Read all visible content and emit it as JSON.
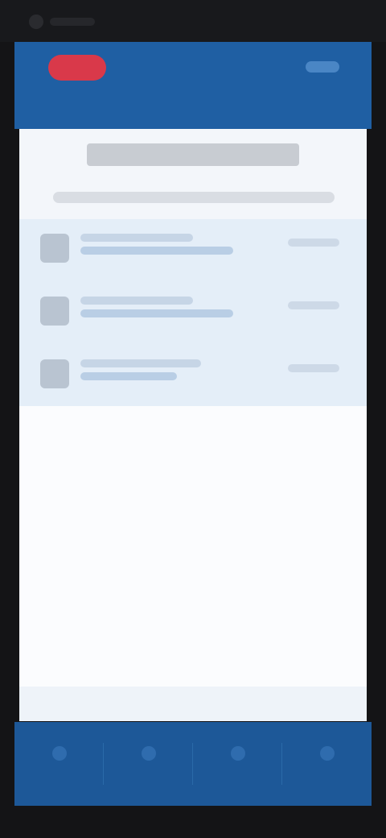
{
  "colors": {
    "header": "#1f5fa3",
    "brand_badge": "#d9394a",
    "content_background": "#f3f6fa",
    "list_background": "#e4eef8",
    "bottom_nav": "#1d5898",
    "frame": "#141416"
  },
  "header": {
    "brand_badge_icon": "brand-logo-icon",
    "action_icon": "menu-icon"
  },
  "list": {
    "items": [
      {
        "icon": "document-icon"
      },
      {
        "icon": "document-icon"
      },
      {
        "icon": "document-icon"
      }
    ]
  },
  "bottom_nav": {
    "items": [
      {
        "icon": "home-icon"
      },
      {
        "icon": "search-icon"
      },
      {
        "icon": "list-icon"
      },
      {
        "icon": "settings-icon"
      }
    ]
  }
}
